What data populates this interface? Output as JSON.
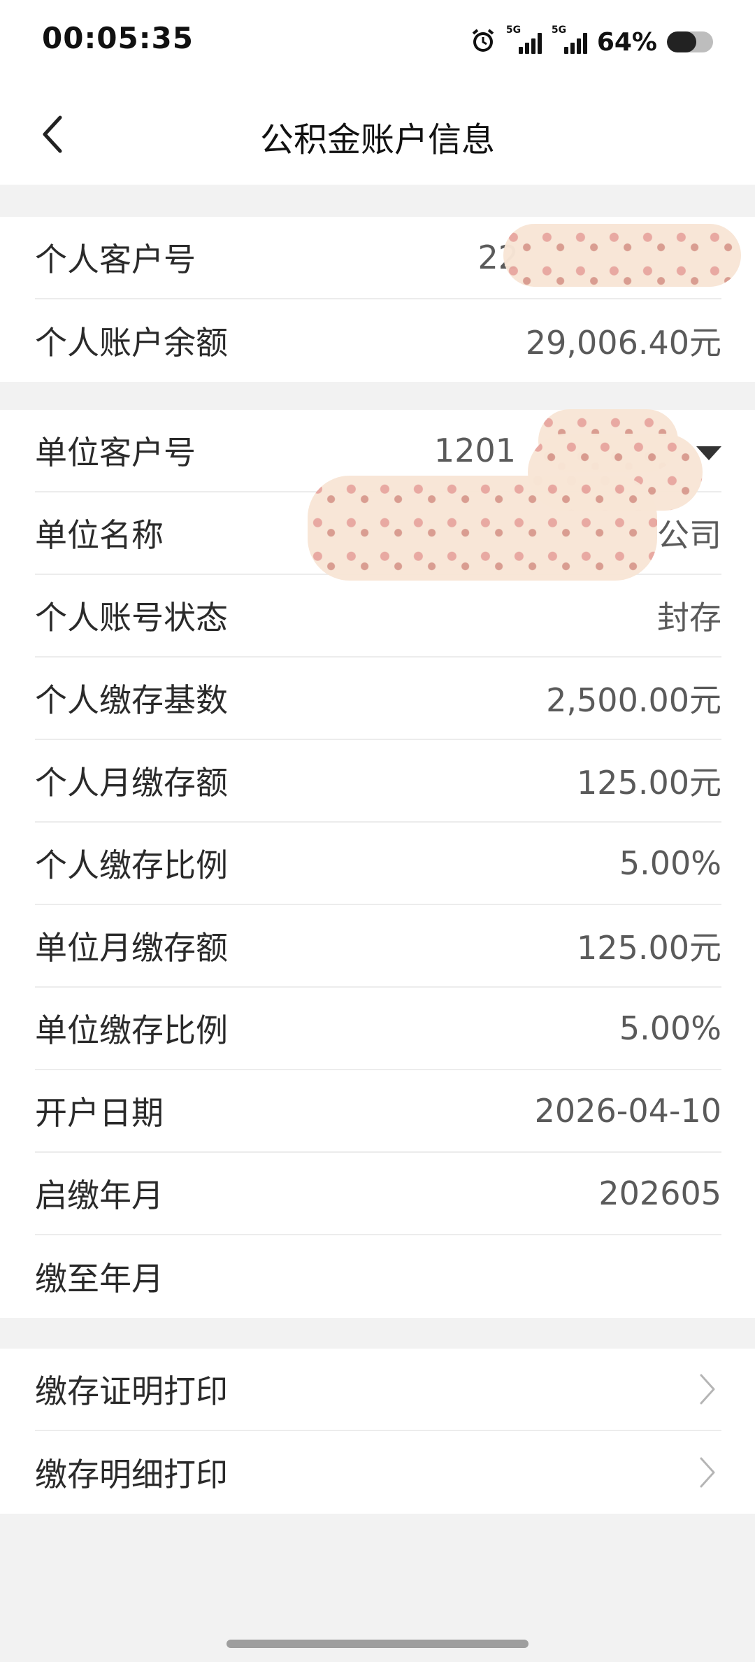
{
  "status_bar": {
    "time": "00:05:35",
    "battery_percent": "64%",
    "icons": [
      "alarm-icon",
      "signal-5g-icon",
      "signal-5g-icon",
      "battery-icon"
    ],
    "signal_tag": "5G"
  },
  "header": {
    "title": "公积金账户信息",
    "back_icon": "chevron-left-icon"
  },
  "personal_section": {
    "rows": [
      {
        "label": "个人客户号",
        "value": "22"
      },
      {
        "label": "个人账户余额",
        "value": "29,006.40元"
      }
    ]
  },
  "unit_section": {
    "rows": [
      {
        "label": "单位客户号",
        "value": "1201"
      },
      {
        "label": "单位名称",
        "value": "公司"
      },
      {
        "label": "个人账号状态",
        "value": "封存"
      },
      {
        "label": "个人缴存基数",
        "value": "2,500.00元"
      },
      {
        "label": "个人月缴存额",
        "value": "125.00元"
      },
      {
        "label": "个人缴存比例",
        "value": "5.00%"
      },
      {
        "label": "单位月缴存额",
        "value": "125.00元"
      },
      {
        "label": "单位缴存比例",
        "value": "5.00%"
      },
      {
        "label": "开户日期",
        "value": "2026-04-10"
      },
      {
        "label": "启缴年月",
        "value": "202605"
      },
      {
        "label": "缴至年月",
        "value": ""
      }
    ]
  },
  "print_section": {
    "items": [
      {
        "label": "缴存证明打印",
        "icon": "chevron-right-icon"
      },
      {
        "label": "缴存明细打印",
        "icon": "chevron-right-icon"
      }
    ]
  },
  "colors": {
    "background": "#f2f2f2",
    "card": "#ffffff",
    "label_text": "#2a2a2a",
    "value_text": "#5a5a5a",
    "divider": "#ececec"
  }
}
